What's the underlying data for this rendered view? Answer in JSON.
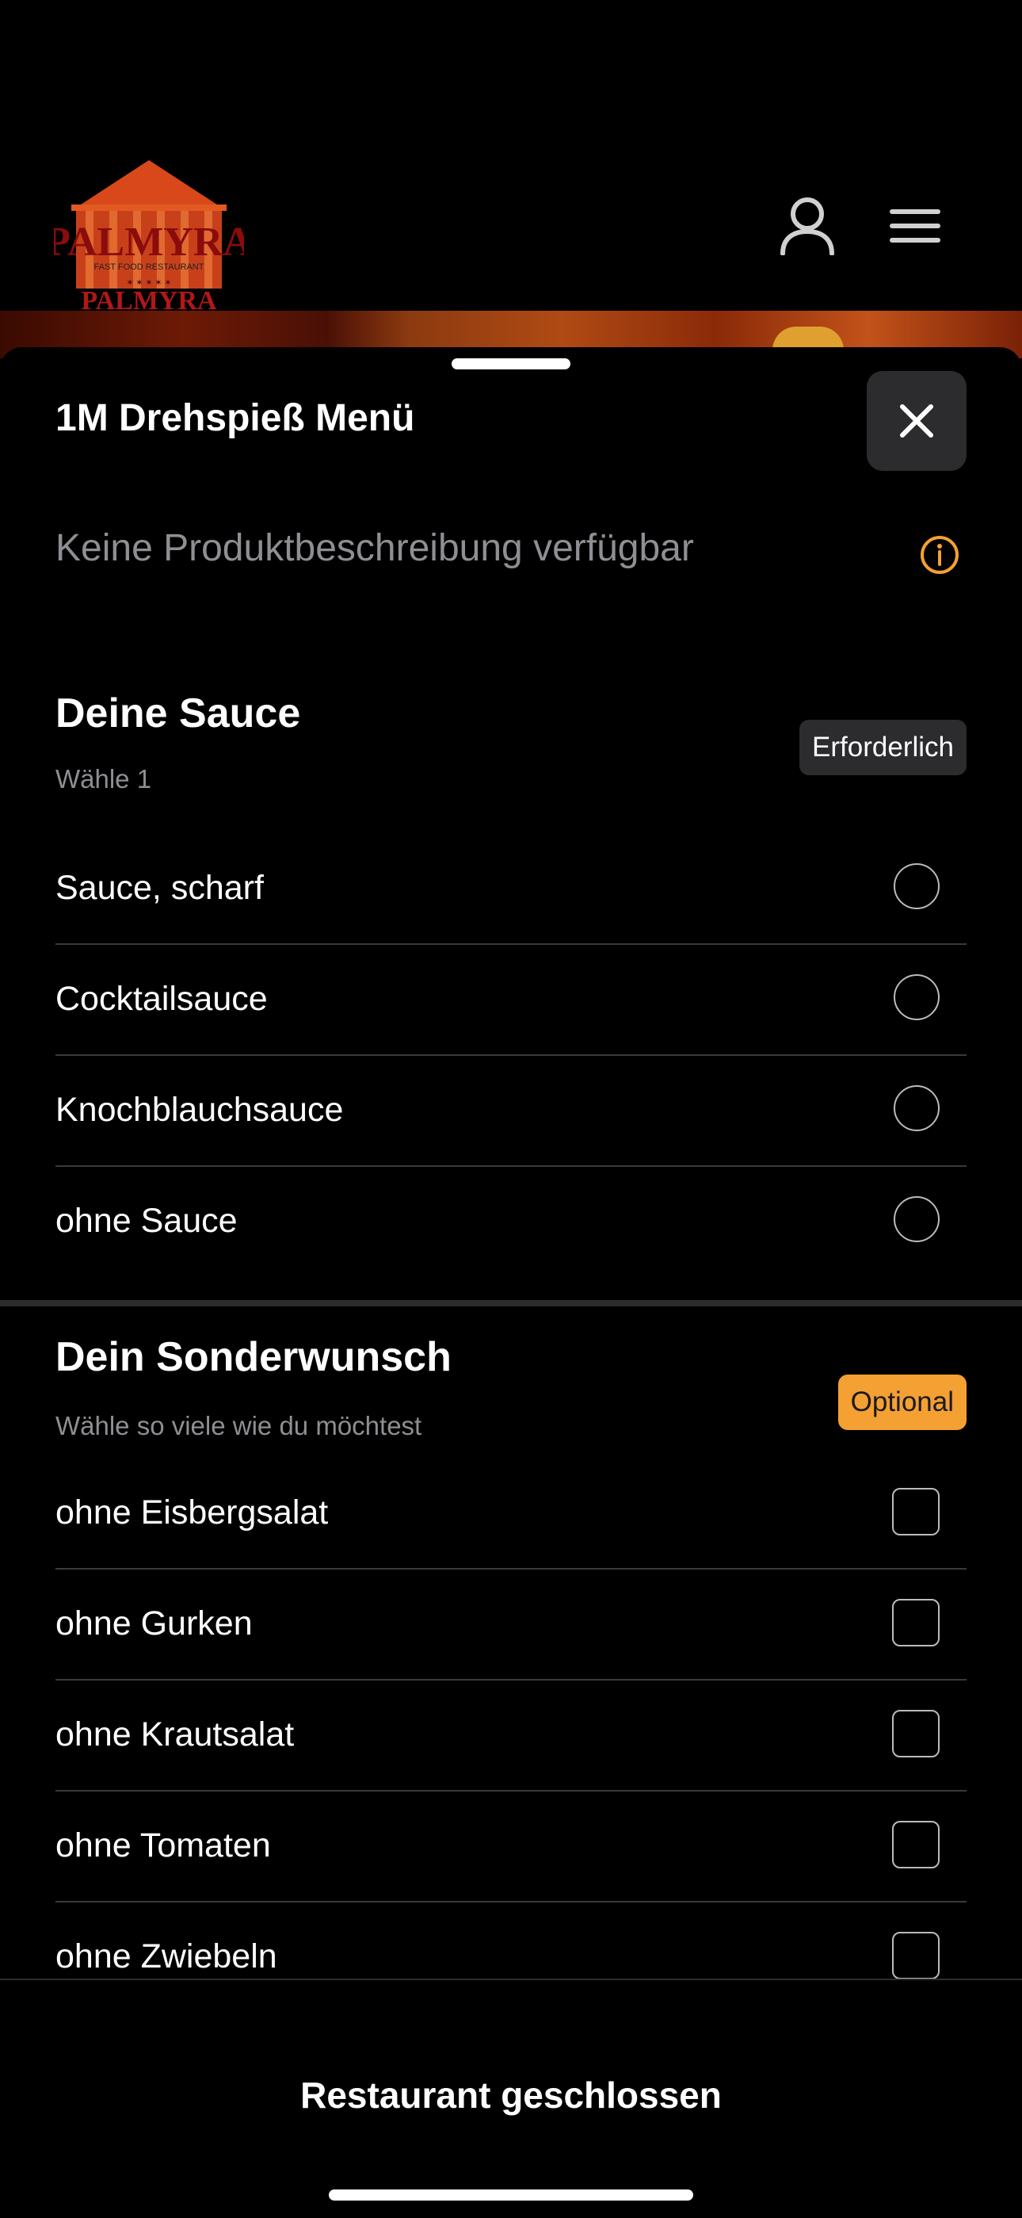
{
  "header": {
    "logo_text": "PALMYRA",
    "logo_tagline": "FAST FOOD RESTAURANT",
    "logo_name": "PALMYRA"
  },
  "product": {
    "title": "1M Drehspieß Menü",
    "description": "Keine Produktbeschreibung verfügbar"
  },
  "groups": [
    {
      "title": "Deine Sauce",
      "subtitle": "Wähle 1",
      "badge": "Erforderlich",
      "options": [
        "Sauce, scharf",
        "Cocktailsauce",
        "Knochblauchsauce",
        "ohne Sauce"
      ]
    },
    {
      "title": "Dein Sonderwunsch",
      "subtitle": "Wähle so viele wie du möchtest",
      "badge": "Optional",
      "options": [
        "ohne Eisbergsalat",
        "ohne Gurken",
        "ohne Krautsalat",
        "ohne Tomaten",
        "ohne Zwiebeln"
      ]
    }
  ],
  "footer": {
    "status": "Restaurant geschlossen"
  },
  "colors": {
    "accent": "#f5a033",
    "background": "#000000",
    "muted": "#8e8e93"
  }
}
